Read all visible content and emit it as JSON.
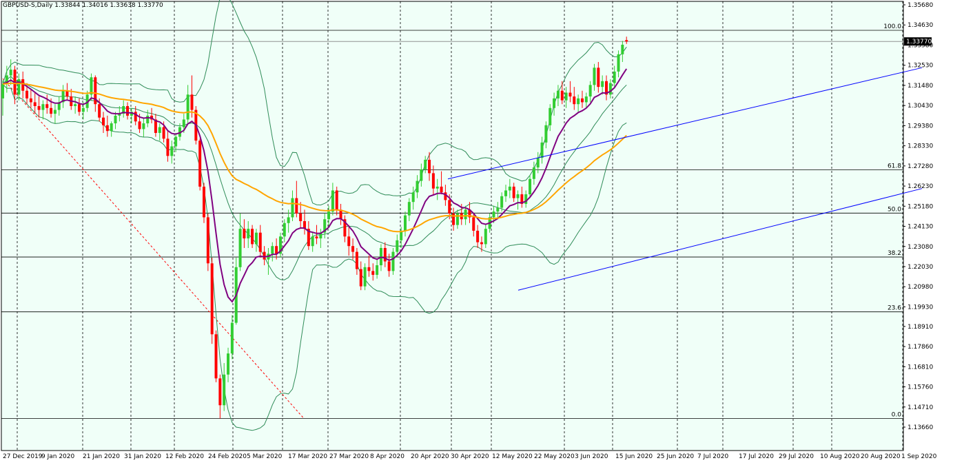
{
  "header": {
    "symbol": "GBPUSD-S,Daily",
    "ohlc": "1.33844 1.34016 1.33638 1.33770"
  },
  "colors": {
    "background": "#f0fff8",
    "bull": "#32cd32",
    "bear": "#ff0000",
    "bollinger": "#2e8b57",
    "ma_fast": "#800080",
    "ma_slow": "#ffa500",
    "channel": "#0000ff",
    "fib_diagonal": "#ff0000",
    "fib_levels": "#000000",
    "grid_vertical": "#000000"
  },
  "chart_data": {
    "type": "candlestick",
    "price_axis_labels": [
      "1.35680",
      "1.34630",
      "1.33580",
      "1.32530",
      "1.31480",
      "1.30430",
      "1.29380",
      "1.28330",
      "1.27280",
      "1.26230",
      "1.25180",
      "1.24130",
      "1.23080",
      "1.22030",
      "1.20980",
      "1.19930",
      "1.18910",
      "1.17860",
      "1.16810",
      "1.15760",
      "1.14710",
      "1.13660"
    ],
    "current_price_label": "1.33770",
    "ylim": [
      1.1366,
      1.3568
    ],
    "date_axis_labels": [
      "27 Dec 2019",
      "9 Jan 2020",
      "21 Jan 2020",
      "31 Jan 2020",
      "12 Feb 2020",
      "24 Feb 2020",
      "5 Mar 2020",
      "17 Mar 2020",
      "27 Mar 2020",
      "8 Apr 2020",
      "20 Apr 2020",
      "30 Apr 2020",
      "12 May 2020",
      "22 May 2020",
      "3 Jun 2020",
      "15 Jun 2020",
      "25 Jun 2020",
      "7 Jul 2020",
      "17 Jul 2020",
      "29 Jul 2020",
      "10 Aug 2020",
      "20 Aug 2020",
      "1 Sep 2020"
    ],
    "fibonacci": [
      {
        "label": "100.0",
        "price": 1.3435
      },
      {
        "label": "61.8",
        "price": 1.2708
      },
      {
        "label": "50.0",
        "price": 1.2482
      },
      {
        "label": "38.2",
        "price": 1.2253
      },
      {
        "label": "23.6",
        "price": 1.1967
      },
      {
        "label": "0.0",
        "price": 1.1411
      }
    ],
    "ohlc": [
      [
        1.308,
        1.3175,
        1.299,
        1.3155
      ],
      [
        1.3155,
        1.325,
        1.311,
        1.32
      ],
      [
        1.32,
        1.3284,
        1.315,
        1.323
      ],
      [
        1.323,
        1.325,
        1.305,
        1.31
      ],
      [
        1.31,
        1.321,
        1.307,
        1.318
      ],
      [
        1.318,
        1.322,
        1.308,
        1.312
      ],
      [
        1.312,
        1.316,
        1.305,
        1.308
      ],
      [
        1.308,
        1.313,
        1.303,
        1.306
      ],
      [
        1.306,
        1.311,
        1.3,
        1.304
      ],
      [
        1.304,
        1.309,
        1.298,
        1.302
      ],
      [
        1.302,
        1.307,
        1.297,
        1.305
      ],
      [
        1.305,
        1.31,
        1.3,
        1.303
      ],
      [
        1.303,
        1.308,
        1.298,
        1.3
      ],
      [
        1.3,
        1.305,
        1.295,
        1.302
      ],
      [
        1.302,
        1.309,
        1.299,
        1.306
      ],
      [
        1.306,
        1.315,
        1.303,
        1.312
      ],
      [
        1.312,
        1.316,
        1.307,
        1.309
      ],
      [
        1.309,
        1.313,
        1.302,
        1.304
      ],
      [
        1.304,
        1.309,
        1.3,
        1.305
      ],
      [
        1.305,
        1.308,
        1.299,
        1.301
      ],
      [
        1.301,
        1.306,
        1.297,
        1.303
      ],
      [
        1.303,
        1.312,
        1.301,
        1.31
      ],
      [
        1.31,
        1.321,
        1.307,
        1.319
      ],
      [
        1.319,
        1.32,
        1.301,
        1.305
      ],
      [
        1.305,
        1.308,
        1.296,
        1.298
      ],
      [
        1.298,
        1.301,
        1.29,
        1.294
      ],
      [
        1.294,
        1.299,
        1.288,
        1.291
      ],
      [
        1.291,
        1.296,
        1.288,
        1.295
      ],
      [
        1.295,
        1.301,
        1.292,
        1.299
      ],
      [
        1.299,
        1.304,
        1.296,
        1.3
      ],
      [
        1.3,
        1.307,
        1.298,
        1.304
      ],
      [
        1.304,
        1.306,
        1.297,
        1.299
      ],
      [
        1.299,
        1.303,
        1.295,
        1.301
      ],
      [
        1.301,
        1.304,
        1.294,
        1.296
      ],
      [
        1.296,
        1.3,
        1.29,
        1.292
      ],
      [
        1.292,
        1.298,
        1.288,
        1.295
      ],
      [
        1.295,
        1.302,
        1.293,
        1.299
      ],
      [
        1.299,
        1.303,
        1.295,
        1.297
      ],
      [
        1.297,
        1.3,
        1.288,
        1.29
      ],
      [
        1.29,
        1.295,
        1.286,
        1.293
      ],
      [
        1.293,
        1.296,
        1.285,
        1.287
      ],
      [
        1.287,
        1.291,
        1.275,
        1.278
      ],
      [
        1.278,
        1.286,
        1.274,
        1.283
      ],
      [
        1.283,
        1.29,
        1.28,
        1.288
      ],
      [
        1.288,
        1.295,
        1.286,
        1.293
      ],
      [
        1.293,
        1.3,
        1.29,
        1.297
      ],
      [
        1.297,
        1.315,
        1.295,
        1.31
      ],
      [
        1.31,
        1.32,
        1.298,
        1.302
      ],
      [
        1.302,
        1.304,
        1.284,
        1.286
      ],
      [
        1.286,
        1.287,
        1.26,
        1.262
      ],
      [
        1.262,
        1.264,
        1.243,
        1.246
      ],
      [
        1.246,
        1.248,
        1.218,
        1.222
      ],
      [
        1.222,
        1.225,
        1.18,
        1.185
      ],
      [
        1.185,
        1.187,
        1.16,
        1.162
      ],
      [
        1.162,
        1.164,
        1.1411,
        1.148
      ],
      [
        1.148,
        1.17,
        1.145,
        1.164
      ],
      [
        1.164,
        1.178,
        1.16,
        1.175
      ],
      [
        1.175,
        1.195,
        1.172,
        1.191
      ],
      [
        1.191,
        1.225,
        1.19,
        1.22
      ],
      [
        1.22,
        1.248,
        1.218,
        1.24
      ],
      [
        1.24,
        1.245,
        1.23,
        1.235
      ],
      [
        1.235,
        1.244,
        1.23,
        1.24
      ],
      [
        1.24,
        1.242,
        1.23,
        1.232
      ],
      [
        1.232,
        1.24,
        1.228,
        1.238
      ],
      [
        1.238,
        1.242,
        1.225,
        1.228
      ],
      [
        1.228,
        1.231,
        1.221,
        1.224
      ],
      [
        1.224,
        1.23,
        1.216,
        1.227
      ],
      [
        1.227,
        1.233,
        1.223,
        1.231
      ],
      [
        1.231,
        1.235,
        1.224,
        1.227
      ],
      [
        1.227,
        1.238,
        1.225,
        1.236
      ],
      [
        1.236,
        1.245,
        1.233,
        1.243
      ],
      [
        1.243,
        1.25,
        1.238,
        1.246
      ],
      [
        1.246,
        1.26,
        1.244,
        1.256
      ],
      [
        1.256,
        1.265,
        1.246,
        1.248
      ],
      [
        1.248,
        1.254,
        1.24,
        1.244
      ],
      [
        1.244,
        1.25,
        1.237,
        1.24
      ],
      [
        1.24,
        1.244,
        1.229,
        1.231
      ],
      [
        1.231,
        1.238,
        1.228,
        1.236
      ],
      [
        1.236,
        1.242,
        1.232,
        1.235
      ],
      [
        1.235,
        1.24,
        1.23,
        1.238
      ],
      [
        1.238,
        1.248,
        1.235,
        1.245
      ],
      [
        1.245,
        1.252,
        1.241,
        1.249
      ],
      [
        1.249,
        1.264,
        1.247,
        1.26
      ],
      [
        1.26,
        1.262,
        1.247,
        1.25
      ],
      [
        1.25,
        1.253,
        1.242,
        1.245
      ],
      [
        1.245,
        1.247,
        1.233,
        1.236
      ],
      [
        1.236,
        1.242,
        1.226,
        1.231
      ],
      [
        1.231,
        1.235,
        1.224,
        1.228
      ],
      [
        1.228,
        1.23,
        1.216,
        1.219
      ],
      [
        1.219,
        1.223,
        1.208,
        1.21
      ],
      [
        1.21,
        1.222,
        1.208,
        1.22
      ],
      [
        1.22,
        1.226,
        1.215,
        1.218
      ],
      [
        1.218,
        1.222,
        1.213,
        1.216
      ],
      [
        1.216,
        1.224,
        1.214,
        1.221
      ],
      [
        1.221,
        1.232,
        1.218,
        1.23
      ],
      [
        1.23,
        1.233,
        1.22,
        1.223
      ],
      [
        1.223,
        1.227,
        1.215,
        1.218
      ],
      [
        1.218,
        1.23,
        1.216,
        1.228
      ],
      [
        1.228,
        1.237,
        1.225,
        1.234
      ],
      [
        1.234,
        1.241,
        1.23,
        1.239
      ],
      [
        1.239,
        1.249,
        1.236,
        1.247
      ],
      [
        1.247,
        1.256,
        1.244,
        1.254
      ],
      [
        1.254,
        1.262,
        1.25,
        1.259
      ],
      [
        1.259,
        1.268,
        1.256,
        1.265
      ],
      [
        1.265,
        1.274,
        1.262,
        1.271
      ],
      [
        1.271,
        1.278,
        1.269,
        1.276
      ],
      [
        1.276,
        1.28,
        1.265,
        1.269
      ],
      [
        1.269,
        1.273,
        1.258,
        1.261
      ],
      [
        1.261,
        1.266,
        1.255,
        1.262
      ],
      [
        1.262,
        1.27,
        1.258,
        1.259
      ],
      [
        1.259,
        1.263,
        1.252,
        1.255
      ],
      [
        1.255,
        1.258,
        1.245,
        1.248
      ],
      [
        1.248,
        1.251,
        1.239,
        1.242
      ],
      [
        1.242,
        1.25,
        1.24,
        1.248
      ],
      [
        1.248,
        1.253,
        1.242,
        1.245
      ],
      [
        1.245,
        1.252,
        1.242,
        1.25
      ],
      [
        1.25,
        1.254,
        1.243,
        1.246
      ],
      [
        1.246,
        1.248,
        1.236,
        1.239
      ],
      [
        1.239,
        1.242,
        1.23,
        1.233
      ],
      [
        1.233,
        1.236,
        1.228,
        1.232
      ],
      [
        1.232,
        1.242,
        1.23,
        1.24
      ],
      [
        1.24,
        1.248,
        1.238,
        1.246
      ],
      [
        1.246,
        1.252,
        1.243,
        1.249
      ],
      [
        1.249,
        1.254,
        1.245,
        1.251
      ],
      [
        1.251,
        1.259,
        1.249,
        1.257
      ],
      [
        1.257,
        1.263,
        1.254,
        1.26
      ],
      [
        1.26,
        1.266,
        1.256,
        1.262
      ],
      [
        1.262,
        1.264,
        1.254,
        1.256
      ],
      [
        1.256,
        1.26,
        1.25,
        1.258
      ],
      [
        1.258,
        1.262,
        1.251,
        1.253
      ],
      [
        1.253,
        1.26,
        1.251,
        1.258
      ],
      [
        1.258,
        1.268,
        1.256,
        1.266
      ],
      [
        1.266,
        1.275,
        1.263,
        1.272
      ],
      [
        1.272,
        1.28,
        1.269,
        1.277
      ],
      [
        1.277,
        1.288,
        1.274,
        1.285
      ],
      [
        1.285,
        1.296,
        1.282,
        1.294
      ],
      [
        1.294,
        1.305,
        1.291,
        1.303
      ],
      [
        1.303,
        1.311,
        1.299,
        1.308
      ],
      [
        1.308,
        1.315,
        1.304,
        1.312
      ],
      [
        1.312,
        1.317,
        1.305,
        1.307
      ],
      [
        1.307,
        1.314,
        1.303,
        1.311
      ],
      [
        1.311,
        1.317,
        1.306,
        1.309
      ],
      [
        1.309,
        1.314,
        1.302,
        1.305
      ],
      [
        1.305,
        1.31,
        1.301,
        1.308
      ],
      [
        1.308,
        1.312,
        1.303,
        1.306
      ],
      [
        1.306,
        1.311,
        1.303,
        1.309
      ],
      [
        1.309,
        1.317,
        1.306,
        1.315
      ],
      [
        1.315,
        1.326,
        1.312,
        1.324
      ],
      [
        1.324,
        1.327,
        1.311,
        1.314
      ],
      [
        1.314,
        1.32,
        1.31,
        1.317
      ],
      [
        1.317,
        1.32,
        1.307,
        1.31
      ],
      [
        1.31,
        1.318,
        1.308,
        1.316
      ],
      [
        1.316,
        1.325,
        1.314,
        1.322
      ],
      [
        1.322,
        1.333,
        1.319,
        1.331
      ],
      [
        1.331,
        1.338,
        1.327,
        1.336
      ],
      [
        1.3384,
        1.3402,
        1.3364,
        1.3377
      ]
    ]
  }
}
